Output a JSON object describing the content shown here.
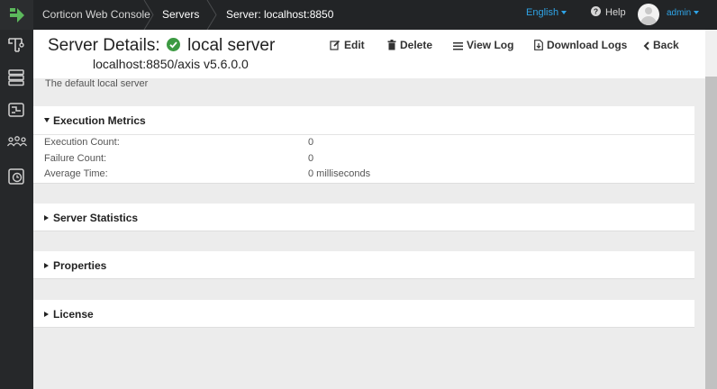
{
  "nav": {
    "app_name": "Corticon Web Console",
    "breadcrumb": [
      "Servers",
      "Server: localhost:8850"
    ],
    "language": "English",
    "help": "Help",
    "user": "admin"
  },
  "header": {
    "title": "Server Details:",
    "server_name": "local server",
    "subtitle": "localhost:8850/axis v5.6.0.0",
    "status": "online",
    "actions": {
      "edit": "Edit",
      "delete": "Delete",
      "view_log": "View Log",
      "download_logs": "Download Logs",
      "back": "Back"
    }
  },
  "description": "The default local server",
  "panels": {
    "execution_metrics": {
      "title": "Execution Metrics",
      "expanded": true,
      "rows": [
        {
          "label": "Execution Count:",
          "value": "0"
        },
        {
          "label": "Failure Count:",
          "value": "0"
        },
        {
          "label": "Average Time:",
          "value": "0 milliseconds"
        }
      ]
    },
    "server_statistics": {
      "title": "Server Statistics",
      "expanded": false
    },
    "properties": {
      "title": "Properties",
      "expanded": false
    },
    "license": {
      "title": "License",
      "expanded": false
    }
  },
  "sidebar": [
    "deployment-icon",
    "database-icon",
    "rules-map-icon",
    "users-icon",
    "monitor-clock-icon"
  ],
  "colors": {
    "topbar": "#222426",
    "sidebar": "#26282a",
    "accent_link": "#2fa4e7",
    "logo_green": "#5cb85c",
    "status_green": "#3c9a42",
    "content_bg": "#ececec"
  }
}
